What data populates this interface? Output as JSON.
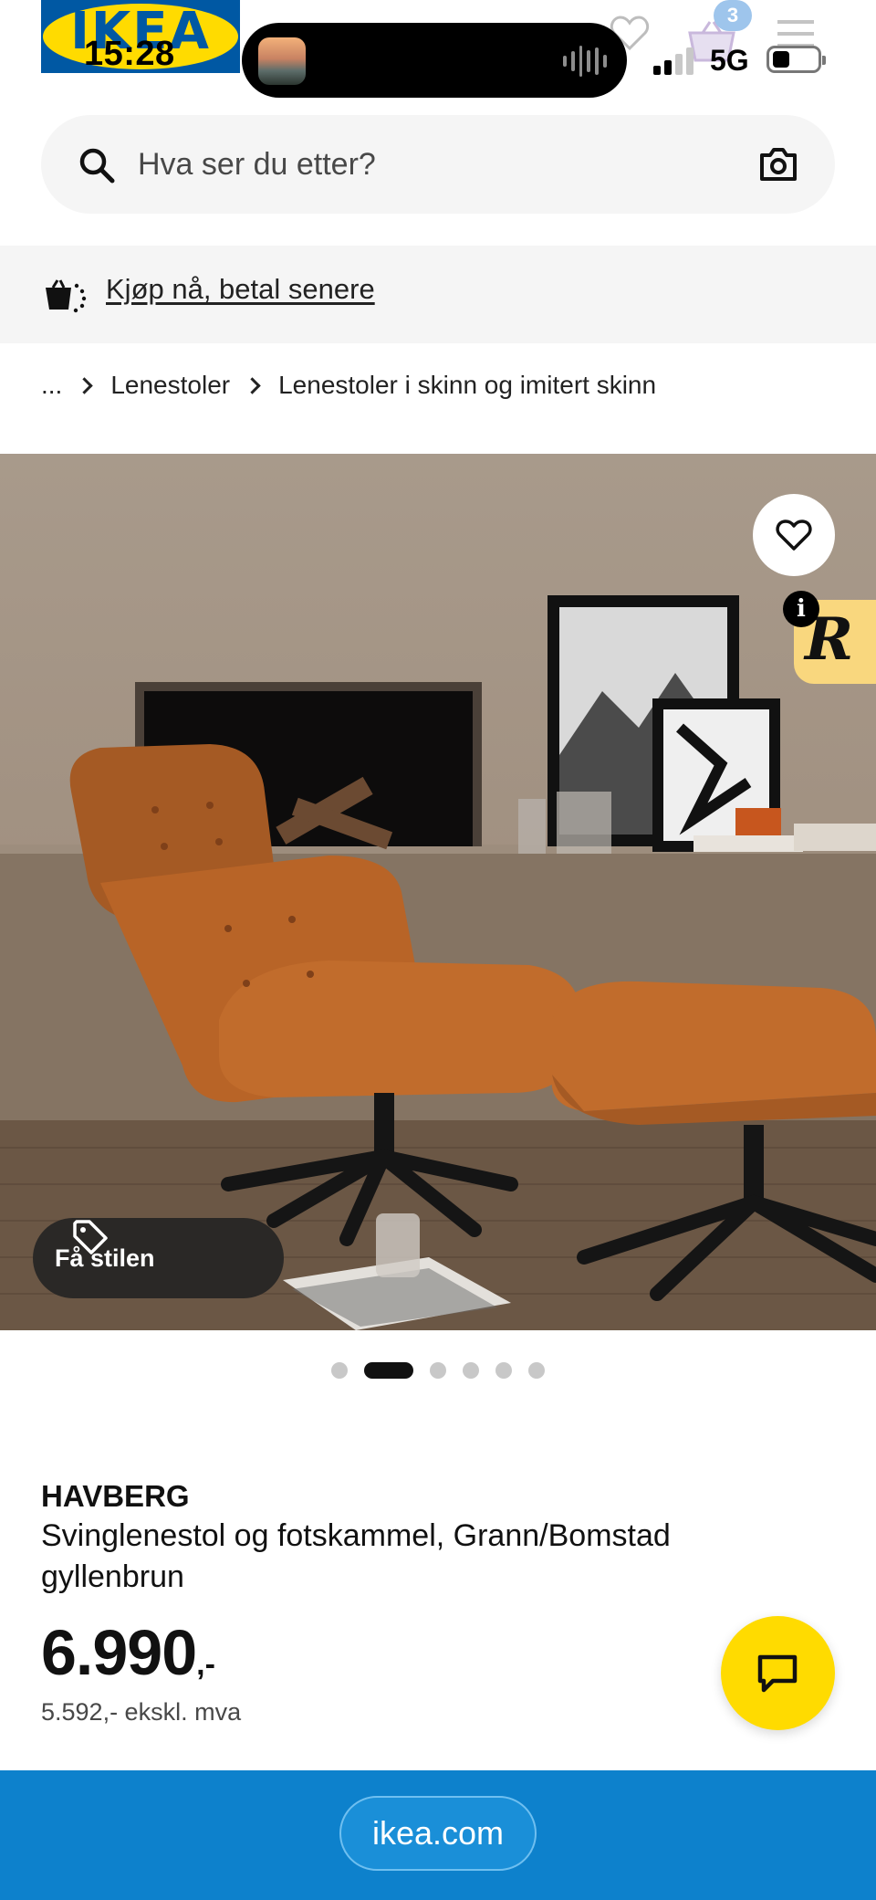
{
  "status_bar": {
    "time": "15:28",
    "network": "5G",
    "cart_count": "3"
  },
  "logo": {
    "text": "IKEA"
  },
  "search": {
    "placeholder": "Hva ser du etter?"
  },
  "banner": {
    "link_text": "Kjøp nå, betal senere"
  },
  "breadcrumb": {
    "items": [
      "...",
      "Lenestoler",
      "Lenestoler i skinn og imitert skinn"
    ]
  },
  "hero": {
    "style_button_label": "Få stilen",
    "badge_letter": "R",
    "info_symbol": "i",
    "slide_count": 6,
    "active_slide": 2
  },
  "product": {
    "name": "HAVBERG",
    "description": "Svinglenestol og fotskammel, Grann/Bomstad gyllenbrun",
    "price": "6.990",
    "price_suffix": ",-",
    "price_ex_vat": "5.592,- ekskl. mva"
  },
  "browser": {
    "url": "ikea.com"
  },
  "colors": {
    "ikea_blue": "#0058a3",
    "ikea_yellow": "#ffdb00",
    "url_bar": "#0d81cc"
  },
  "icons": [
    "search-icon",
    "camera-icon",
    "heart-icon",
    "cart-icon",
    "menu-icon",
    "tag-icon",
    "chat-icon",
    "pay-later-icon"
  ]
}
